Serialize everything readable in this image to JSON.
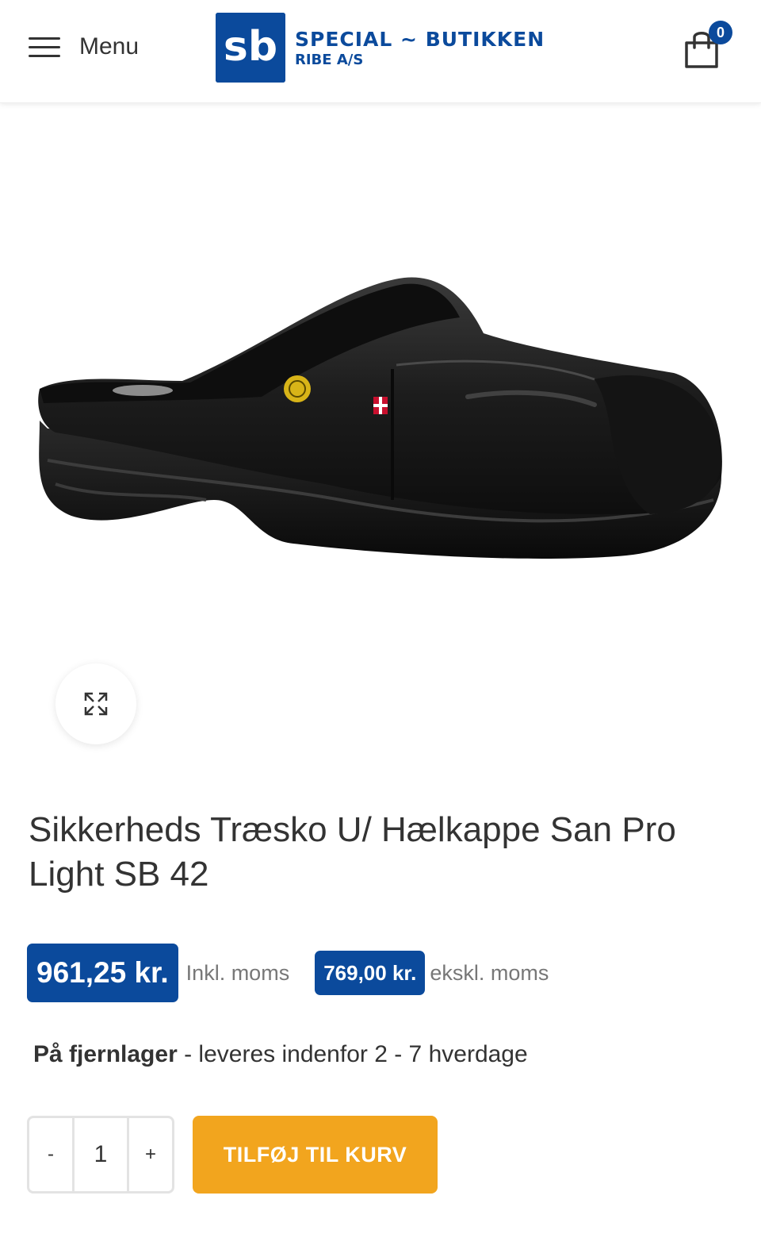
{
  "header": {
    "menu_label": "Menu",
    "logo": {
      "mark": "sb",
      "line1": "SPECIAL ~ BUTIKKEN",
      "line2": "RIBE A/S"
    },
    "cart_count": "0",
    "brand_color": "#0b4a9c"
  },
  "product": {
    "image_icon": "safety-clog-image",
    "title": "Sikkerheds Træsko U/ Hælkappe San Pro Light SB 42",
    "price_incl": "961,25 kr.",
    "price_incl_label": "Inkl. moms",
    "price_excl": "769,00 kr.",
    "price_excl_label": "ekskl. moms",
    "stock_status": "På fjernlager",
    "stock_separator": " - ",
    "stock_delivery": "leveres indenfor 2 - 7 hverdage"
  },
  "cart_form": {
    "minus_label": "-",
    "quantity": "1",
    "plus_label": "+",
    "add_to_cart_label": "TILFØJ TIL KURV",
    "button_color": "#f2a51e"
  }
}
